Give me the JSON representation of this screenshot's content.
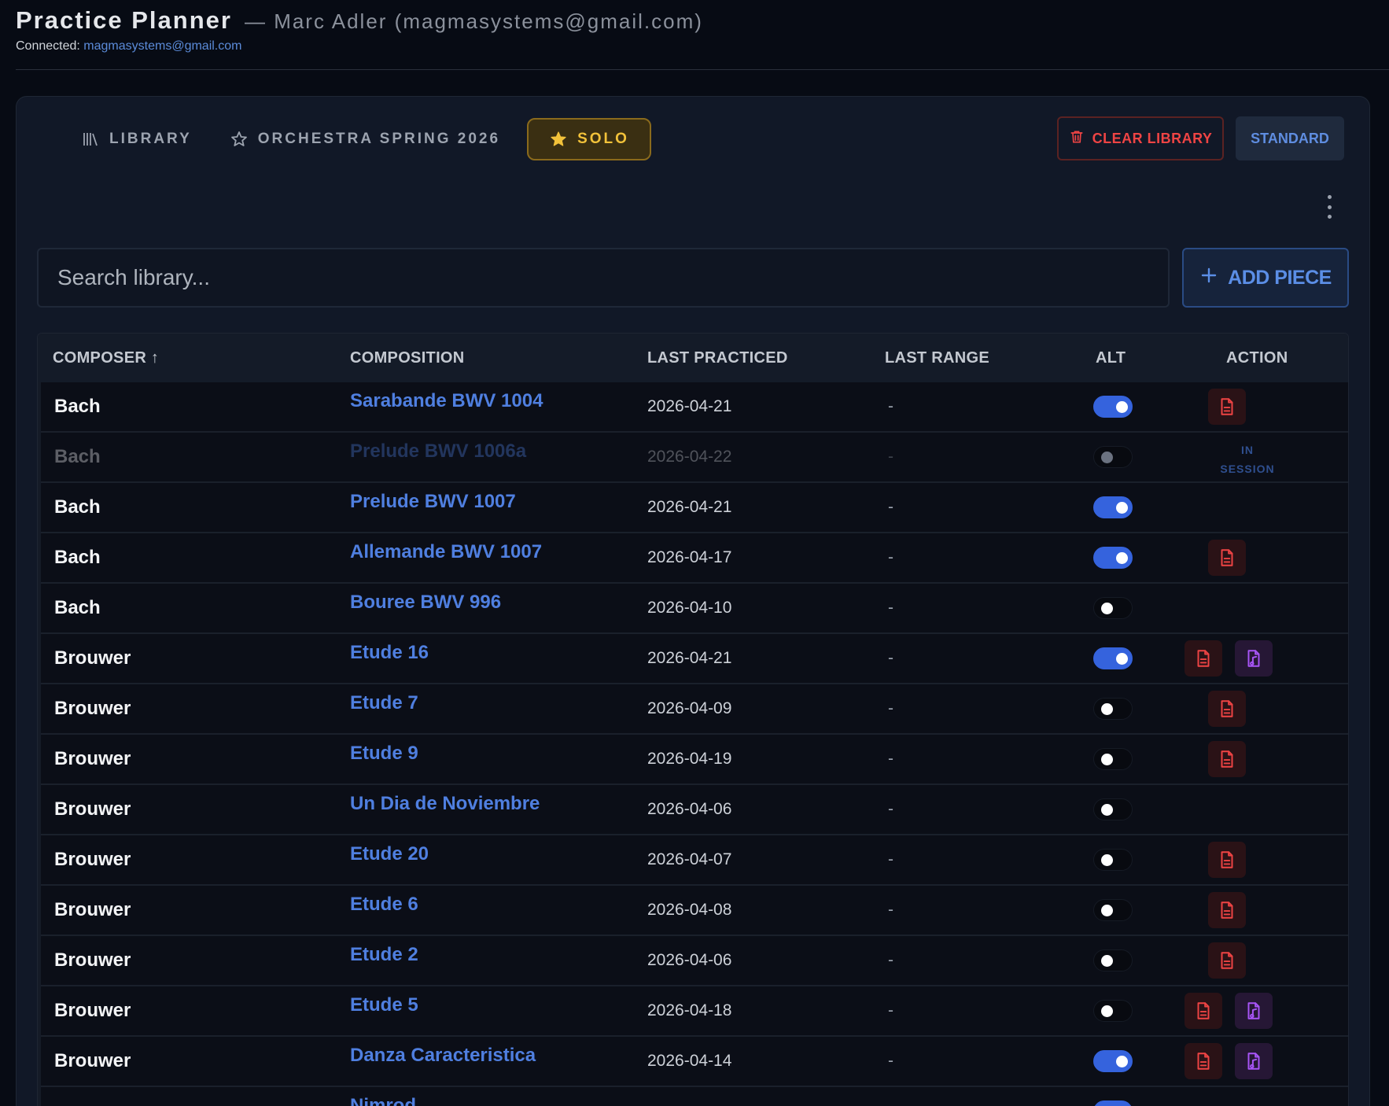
{
  "header": {
    "title": "Practice Planner",
    "subtitle": "— Marc Adler (magmasystems@gmail.com)",
    "connected_label": "Connected:",
    "connected_email": "magmasystems@gmail.com"
  },
  "tabs": [
    {
      "label": "LIBRARY",
      "icon": "library-icon",
      "active": false
    },
    {
      "label": "ORCHESTRA SPRING 2026",
      "icon": "star-outline-icon",
      "active": false
    },
    {
      "label": "SOLO",
      "icon": "star-filled-icon",
      "active": true
    }
  ],
  "toolbar": {
    "clear_label": "CLEAR LIBRARY",
    "standard_label": "STANDARD"
  },
  "search": {
    "placeholder": "Search library..."
  },
  "add_label": "ADD PIECE",
  "table": {
    "headers": {
      "composer": "COMPOSER ↑",
      "composition": "COMPOSITION",
      "last_practiced": "LAST PRACTICED",
      "last_range": "LAST RANGE",
      "alt": "ALT",
      "action": "ACTION"
    },
    "in_session_label": "IN SESSION",
    "rows": [
      {
        "composer": "Bach",
        "composition": "Sarabande BWV 1004",
        "last": "2026-04-21",
        "range": "-",
        "alt": true,
        "pdf": true,
        "score": false,
        "in_session": false
      },
      {
        "composer": "Bach",
        "composition": "Prelude BWV 1006a",
        "last": "2026-04-22",
        "range": "-",
        "alt": false,
        "pdf": false,
        "score": false,
        "in_session": true
      },
      {
        "composer": "Bach",
        "composition": "Prelude BWV 1007",
        "last": "2026-04-21",
        "range": "-",
        "alt": true,
        "pdf": false,
        "score": false,
        "in_session": false
      },
      {
        "composer": "Bach",
        "composition": "Allemande BWV 1007",
        "last": "2026-04-17",
        "range": "-",
        "alt": true,
        "pdf": true,
        "score": false,
        "in_session": false
      },
      {
        "composer": "Bach",
        "composition": "Bouree BWV 996",
        "last": "2026-04-10",
        "range": "-",
        "alt": false,
        "pdf": false,
        "score": false,
        "in_session": false
      },
      {
        "composer": "Brouwer",
        "composition": "Etude 16",
        "last": "2026-04-21",
        "range": "-",
        "alt": true,
        "pdf": true,
        "score": true,
        "in_session": false
      },
      {
        "composer": "Brouwer",
        "composition": "Etude 7",
        "last": "2026-04-09",
        "range": "-",
        "alt": false,
        "pdf": true,
        "score": false,
        "in_session": false
      },
      {
        "composer": "Brouwer",
        "composition": "Etude 9",
        "last": "2026-04-19",
        "range": "-",
        "alt": false,
        "pdf": true,
        "score": false,
        "in_session": false
      },
      {
        "composer": "Brouwer",
        "composition": "Un Dia de Noviembre",
        "last": "2026-04-06",
        "range": "-",
        "alt": false,
        "pdf": false,
        "score": false,
        "in_session": false
      },
      {
        "composer": "Brouwer",
        "composition": "Etude 20",
        "last": "2026-04-07",
        "range": "-",
        "alt": false,
        "pdf": true,
        "score": false,
        "in_session": false
      },
      {
        "composer": "Brouwer",
        "composition": "Etude 6",
        "last": "2026-04-08",
        "range": "-",
        "alt": false,
        "pdf": true,
        "score": false,
        "in_session": false
      },
      {
        "composer": "Brouwer",
        "composition": "Etude 2",
        "last": "2026-04-06",
        "range": "-",
        "alt": false,
        "pdf": true,
        "score": false,
        "in_session": false
      },
      {
        "composer": "Brouwer",
        "composition": "Etude 5",
        "last": "2026-04-18",
        "range": "-",
        "alt": false,
        "pdf": true,
        "score": true,
        "in_session": false
      },
      {
        "composer": "Brouwer",
        "composition": "Danza Caracteristica",
        "last": "2026-04-14",
        "range": "-",
        "alt": true,
        "pdf": true,
        "score": true,
        "in_session": false
      },
      {
        "composer": "",
        "composition": "Nimrod",
        "last": "",
        "range": "",
        "alt": true,
        "pdf": false,
        "score": false,
        "in_session": false
      }
    ]
  },
  "colors": {
    "accent": "#3563dd",
    "link": "#4f7fe0",
    "solo_gold": "#f2c23a",
    "danger": "#ef4444",
    "score_purple": "#a855f7"
  }
}
